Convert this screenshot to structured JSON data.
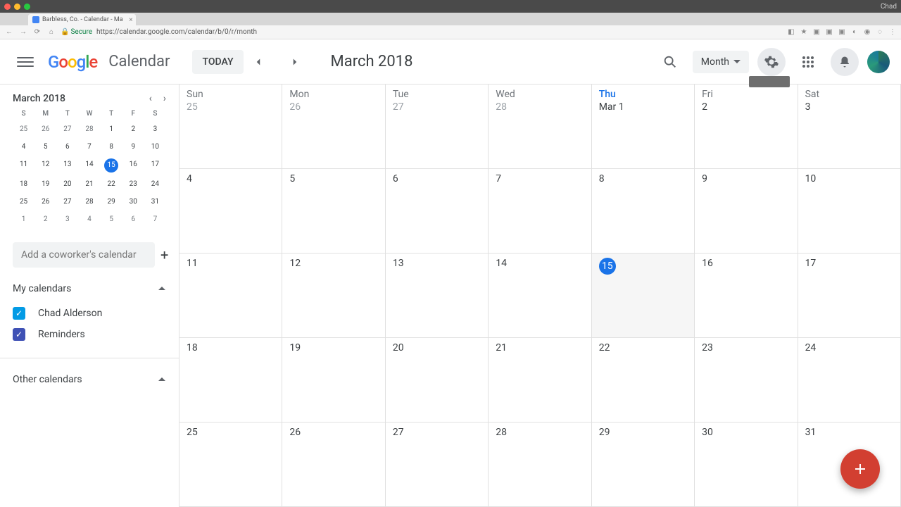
{
  "mac": {
    "user": "Chad"
  },
  "browser": {
    "tab_title": "Barbless, Co. - Calendar - Ma",
    "secure_label": "Secure",
    "url": "https://calendar.google.com/calendar/b/0/r/month"
  },
  "header": {
    "logo_word": "Calendar",
    "today": "TODAY",
    "month_title": "March 2018",
    "view_label": "Month"
  },
  "sidebar": {
    "mini_month": "March 2018",
    "dows": [
      "S",
      "M",
      "T",
      "W",
      "T",
      "F",
      "S"
    ],
    "mini_days": [
      {
        "n": "25",
        "dim": true
      },
      {
        "n": "26",
        "dim": true
      },
      {
        "n": "27",
        "dim": true
      },
      {
        "n": "28",
        "dim": true
      },
      {
        "n": "1"
      },
      {
        "n": "2"
      },
      {
        "n": "3"
      },
      {
        "n": "4"
      },
      {
        "n": "5"
      },
      {
        "n": "6"
      },
      {
        "n": "7"
      },
      {
        "n": "8"
      },
      {
        "n": "9"
      },
      {
        "n": "10"
      },
      {
        "n": "11"
      },
      {
        "n": "12"
      },
      {
        "n": "13"
      },
      {
        "n": "14"
      },
      {
        "n": "15",
        "today": true
      },
      {
        "n": "16"
      },
      {
        "n": "17"
      },
      {
        "n": "18"
      },
      {
        "n": "19"
      },
      {
        "n": "20"
      },
      {
        "n": "21"
      },
      {
        "n": "22"
      },
      {
        "n": "23"
      },
      {
        "n": "24"
      },
      {
        "n": "25"
      },
      {
        "n": "26"
      },
      {
        "n": "27"
      },
      {
        "n": "28"
      },
      {
        "n": "29"
      },
      {
        "n": "30"
      },
      {
        "n": "31"
      },
      {
        "n": "1",
        "dim": true
      },
      {
        "n": "2",
        "dim": true
      },
      {
        "n": "3",
        "dim": true
      },
      {
        "n": "4",
        "dim": true
      },
      {
        "n": "5",
        "dim": true
      },
      {
        "n": "6",
        "dim": true
      },
      {
        "n": "7",
        "dim": true
      }
    ],
    "add_coworker_placeholder": "Add a coworker's calendar",
    "my_calendars_label": "My calendars",
    "calendars": [
      {
        "label": "Chad Alderson",
        "color": "blue"
      },
      {
        "label": "Reminders",
        "color": "indigo"
      }
    ],
    "other_calendars_label": "Other calendars"
  },
  "grid": {
    "dows": [
      "Sun",
      "Mon",
      "Tue",
      "Wed",
      "Thu",
      "Fri",
      "Sat"
    ],
    "today_dow_index": 4,
    "cells": [
      {
        "n": "25",
        "dim": true
      },
      {
        "n": "26",
        "dim": true
      },
      {
        "n": "27",
        "dim": true
      },
      {
        "n": "28",
        "dim": true
      },
      {
        "n": "Mar 1"
      },
      {
        "n": "2"
      },
      {
        "n": "3"
      },
      {
        "n": "4"
      },
      {
        "n": "5"
      },
      {
        "n": "6"
      },
      {
        "n": "7"
      },
      {
        "n": "8"
      },
      {
        "n": "9"
      },
      {
        "n": "10"
      },
      {
        "n": "11"
      },
      {
        "n": "12"
      },
      {
        "n": "13"
      },
      {
        "n": "14"
      },
      {
        "n": "15",
        "today": true
      },
      {
        "n": "16"
      },
      {
        "n": "17"
      },
      {
        "n": "18"
      },
      {
        "n": "19"
      },
      {
        "n": "20"
      },
      {
        "n": "21"
      },
      {
        "n": "22"
      },
      {
        "n": "23"
      },
      {
        "n": "24"
      },
      {
        "n": "25"
      },
      {
        "n": "26"
      },
      {
        "n": "27"
      },
      {
        "n": "28"
      },
      {
        "n": "29"
      },
      {
        "n": "30"
      },
      {
        "n": "31"
      }
    ]
  }
}
